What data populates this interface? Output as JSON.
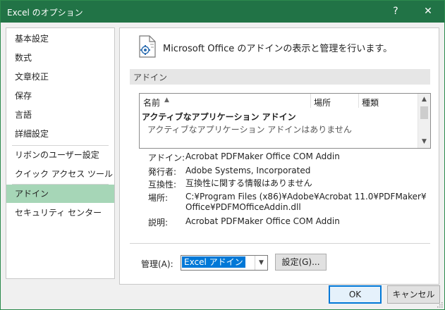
{
  "window": {
    "title": "Excel のオプション",
    "help_label": "?",
    "close_label": "✕"
  },
  "sidebar": {
    "items": [
      {
        "label": "基本設定"
      },
      {
        "label": "数式"
      },
      {
        "label": "文章校正"
      },
      {
        "label": "保存"
      },
      {
        "label": "言語"
      },
      {
        "label": "詳細設定"
      },
      {
        "label": "リボンのユーザー設定"
      },
      {
        "label": "クイック アクセス ツール バー"
      },
      {
        "label": "アドイン",
        "selected": true
      },
      {
        "label": "セキュリティ センター"
      }
    ]
  },
  "main": {
    "header_text": "Microsoft Office のアドインの表示と管理を行います。",
    "section_title": "アドイン",
    "list": {
      "columns": [
        "名前",
        "場所",
        "種類"
      ],
      "sort_indicator": "▲",
      "group_title": "アクティブなアプリケーション アドイン",
      "group_empty_text": "アクティブなアプリケーション アドインはありません",
      "scroll_up": "▲",
      "scroll_down": "▼"
    },
    "details": {
      "addin_label": "アドイン:",
      "addin_value": "Acrobat PDFMaker Office COM Addin",
      "publisher_label": "発行者:",
      "publisher_value": "Adobe Systems, Incorporated",
      "compat_label": "互換性:",
      "compat_value": "互換性に関する情報はありません",
      "location_label": "場所:",
      "location_value_line1": "C:¥Program Files (x86)¥Adobe¥Acrobat 11.0¥PDFMaker¥",
      "location_value_line2": "Office¥PDFMOfficeAddin.dll",
      "description_label": "説明:",
      "description_value": "Acrobat PDFMaker Office COM Addin"
    },
    "manage": {
      "label": "管理(A):",
      "selected_value": "Excel アドイン",
      "dropdown_arrow": "▼",
      "go_label": "設定(G)..."
    }
  },
  "footer": {
    "ok_label": "OK",
    "cancel_label": "キャンセル"
  },
  "colors": {
    "title_bar": "#217346",
    "selected_nav": "#a6d6b7",
    "select_highlight": "#0078d7"
  },
  "icons": {
    "header": "addin-document-icon",
    "close": "close-icon",
    "help": "help-icon"
  }
}
